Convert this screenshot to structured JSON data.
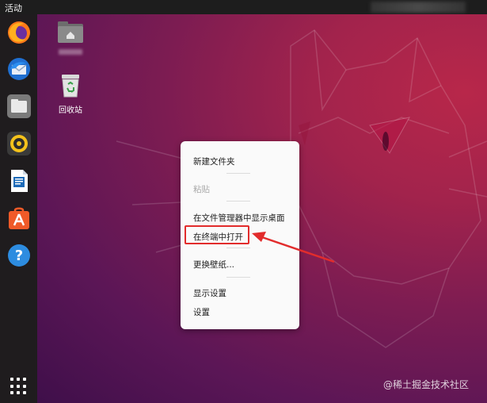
{
  "topbar": {
    "activities": "活动"
  },
  "dock": {
    "items": [
      {
        "name": "firefox-icon"
      },
      {
        "name": "thunderbird-icon"
      },
      {
        "name": "files-icon"
      },
      {
        "name": "rhythmbox-icon"
      },
      {
        "name": "libreoffice-writer-icon"
      },
      {
        "name": "software-center-icon"
      },
      {
        "name": "help-icon"
      }
    ],
    "show_apps": "apps-grid-icon"
  },
  "desktop": {
    "trash_label": "回收站"
  },
  "context_menu": {
    "items": [
      {
        "label": "新建文件夹",
        "enabled": true
      },
      {
        "label": "粘贴",
        "enabled": false
      },
      {
        "label": "在文件管理器中显示桌面",
        "enabled": true
      },
      {
        "label": "在终端中打开",
        "enabled": true,
        "highlighted": true
      },
      {
        "label": "更换壁纸...",
        "enabled": true
      },
      {
        "label": "显示设置",
        "enabled": true
      },
      {
        "label": "设置",
        "enabled": true
      }
    ]
  },
  "annotation": {
    "highlight_color": "#e22c2c"
  },
  "watermark": "@稀土掘金技术社区"
}
